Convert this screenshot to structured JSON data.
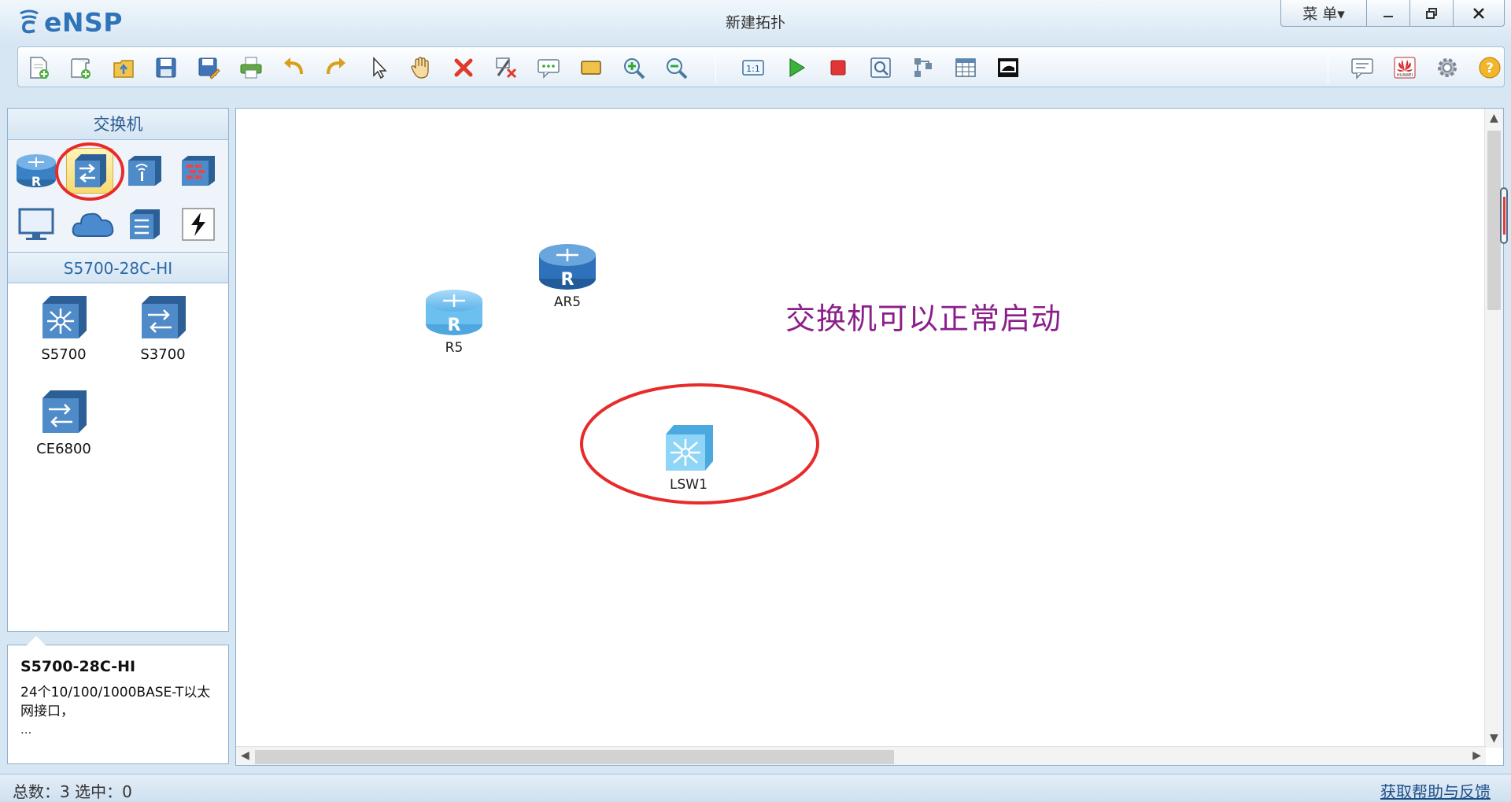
{
  "app": {
    "logo_text": "eNSP",
    "window_title": "新建拓扑",
    "menu_label": "菜 单▾",
    "min_glyph": "—",
    "max_glyph": "🗗",
    "close_glyph": "✕"
  },
  "toolbar": {
    "icons": [
      "new-topology-icon",
      "new-lab-icon",
      "open-icon",
      "save-icon",
      "save-as-icon",
      "print-icon",
      "undo-icon",
      "redo-icon",
      "select-icon",
      "pan-hand-icon",
      "delete-icon",
      "delete-link-icon",
      "text-annotation-icon",
      "rectangle-icon",
      "zoom-in-icon",
      "zoom-out-icon",
      "fit-view-icon",
      "start-devices-icon",
      "stop-devices-icon",
      "capture-icon",
      "topology-icon",
      "grid-icon",
      "display-icon"
    ],
    "right_icons": [
      "feedback-icon",
      "huawei-icon",
      "settings-icon",
      "help-icon"
    ]
  },
  "device_panel": {
    "category_title": "交换机",
    "model_section_title": "S5700-28C-HI",
    "categories": [
      {
        "name": "router",
        "selected": false
      },
      {
        "name": "switch",
        "selected": true
      },
      {
        "name": "wireless",
        "selected": false
      },
      {
        "name": "firewall",
        "selected": false
      },
      {
        "name": "terminal",
        "selected": false
      },
      {
        "name": "cloud",
        "selected": false
      },
      {
        "name": "other-device",
        "selected": false
      },
      {
        "name": "connection",
        "selected": false
      }
    ],
    "models": [
      {
        "label": "S5700"
      },
      {
        "label": "S3700"
      },
      {
        "label": "CE6800"
      }
    ]
  },
  "info": {
    "title": "S5700-28C-HI",
    "description": "24个10/100/1000BASE-T以太网接口，",
    "more": "..."
  },
  "canvas": {
    "annotation": "交换机可以正常启动",
    "devices": [
      {
        "label": "R5"
      },
      {
        "label": "AR5"
      },
      {
        "label": "LSW1"
      }
    ]
  },
  "status": {
    "left": "总数：3  选中：0",
    "right": "获取帮助与反馈"
  },
  "colors": {
    "accent": "#2f73b8",
    "annotation": "#8a1f8a",
    "highlight_circle": "#e82a2a"
  }
}
